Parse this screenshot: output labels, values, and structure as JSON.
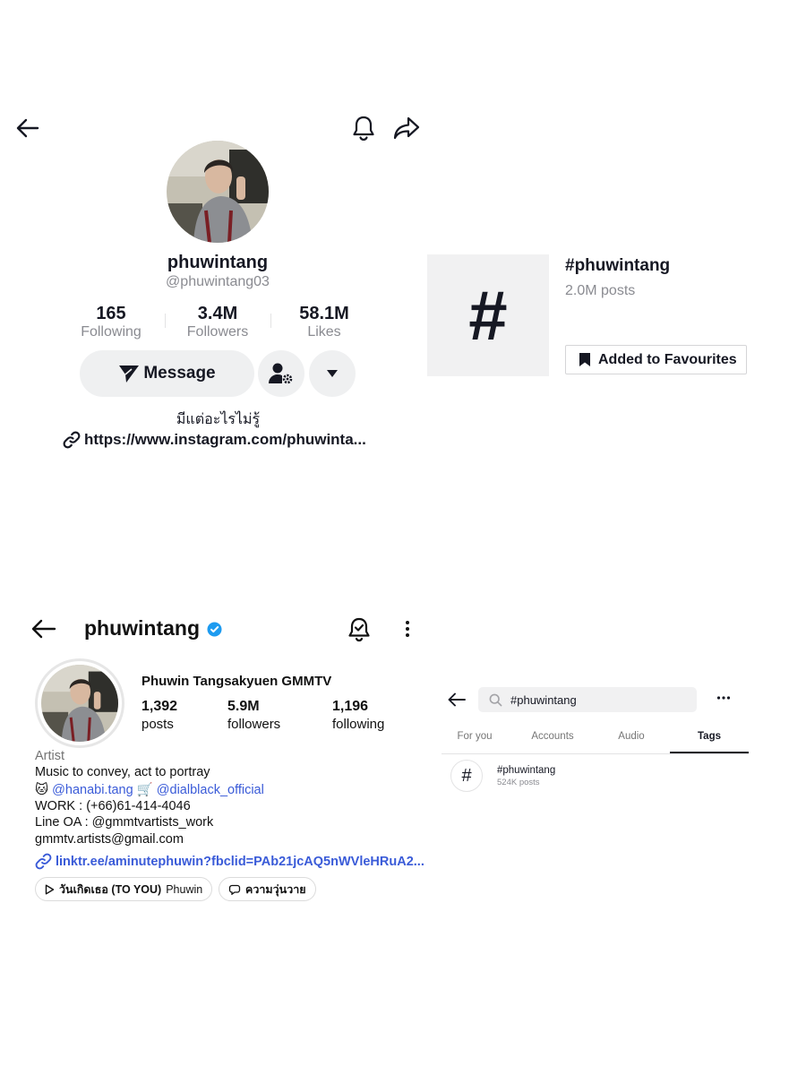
{
  "tiktok_profile": {
    "username": "phuwintang",
    "handle": "@phuwintang03",
    "stats": [
      {
        "value": "165",
        "label": "Following"
      },
      {
        "value": "3.4M",
        "label": "Followers"
      },
      {
        "value": "58.1M",
        "label": "Likes"
      }
    ],
    "message_label": "Message",
    "bio": "มีแต่อะไรไม่รู้",
    "link": "https://www.instagram.com/phuwinta..."
  },
  "tiktok_tag": {
    "symbol": "#",
    "title": "#phuwintang",
    "posts": "2.0M posts",
    "favourite_label": "Added to Favourites"
  },
  "instagram_profile": {
    "username": "phuwintang",
    "verified_color": "#1d9bf0",
    "full_name": "Phuwin Tangsakyuen GMMTV",
    "stats": [
      {
        "value": "1,392",
        "label": "posts"
      },
      {
        "value": "5.9M",
        "label": "followers"
      },
      {
        "value": "1,196",
        "label": "following"
      }
    ],
    "category": "Artist",
    "bio_line1": "Music to convey, act to portray",
    "mention1_emoji": "🐱",
    "mention1": "@hanabi.tang",
    "mention2_emoji": "🛒",
    "mention2": "@dialblack_official",
    "work": "WORK : (+66)61-414-4046",
    "line_oa": "Line OA : @gmmtvartists_work",
    "email": "gmmtv.artists@gmail.com",
    "link": "linktr.ee/aminutephuwin?fbclid=PAb21jcAQ5nWVleHRuA2...",
    "chip1_title": "วันเกิดเธอ (TO YOU)",
    "chip1_artist": "Phuwin",
    "chip2_label": "ความวุ่นวาย"
  },
  "tiktok_search": {
    "query": "#phuwintang",
    "tabs": [
      "For you",
      "Accounts",
      "Audio",
      "Tags"
    ],
    "active_tab": "Tags",
    "result_symbol": "#",
    "result_title": "#phuwintang",
    "result_posts": "524K posts"
  },
  "icons": [
    "back-arrow-icon",
    "bell-icon",
    "share-icon",
    "send-icon",
    "add-user-settings-icon",
    "caret-down-icon",
    "link-icon",
    "hashtag-icon",
    "bookmark-icon",
    "verified-badge-icon",
    "bell-check-icon",
    "more-vertical-icon",
    "play-icon",
    "threads-icon",
    "search-icon",
    "more-horizontal-icon"
  ]
}
